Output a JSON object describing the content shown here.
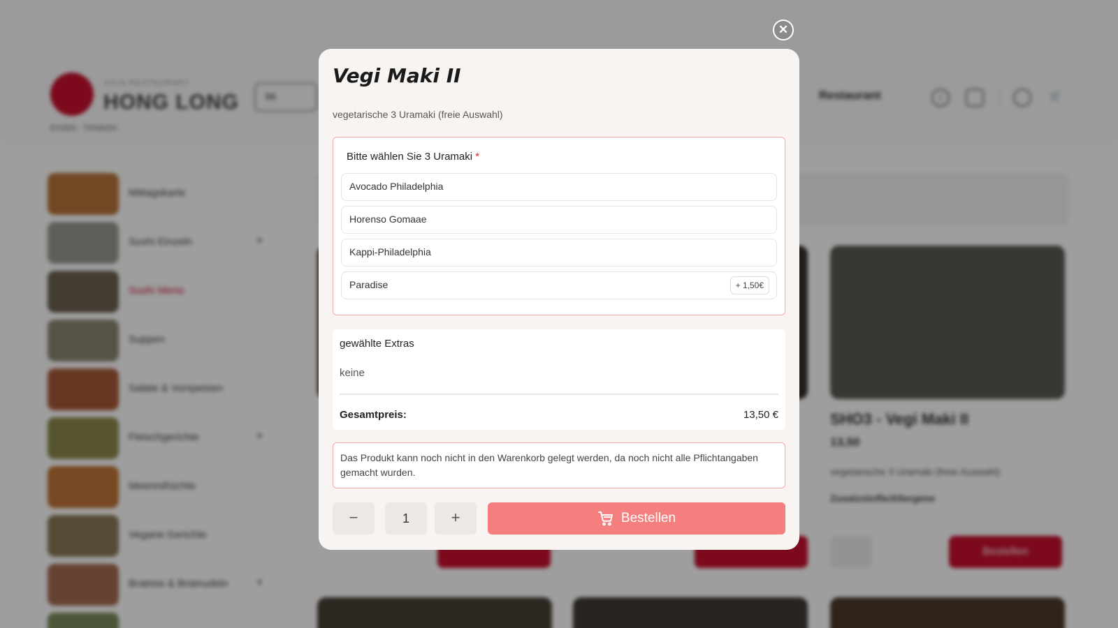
{
  "modal": {
    "title": "Vegi Maki II",
    "description": "vegetarische 3 Uramaki (freie Auswahl)",
    "option_group": {
      "label": "Bitte wählen Sie 3 Uramaki",
      "required_marker": "*",
      "options": [
        {
          "name": "Avocado Philadelphia",
          "surcharge": ""
        },
        {
          "name": "Horenso Gomaae",
          "surcharge": ""
        },
        {
          "name": "Kappi-Philadelphia",
          "surcharge": ""
        },
        {
          "name": "Paradise",
          "surcharge": "+ 1,50€"
        }
      ]
    },
    "extras": {
      "title": "gewählte Extras",
      "value": "keine",
      "total_label": "Gesamtpreis:",
      "total_value": "13,50 €"
    },
    "warning": "Das Produkt kann noch nicht in den Warenkorb gelegt werden, da noch nicht alle Pflichtangaben gemacht wurden.",
    "quantity": {
      "minus": "−",
      "value": "1",
      "plus": "+"
    },
    "order_button": "Bestellen",
    "close": "✕"
  },
  "background": {
    "brand": "HONG LONG",
    "sidebar_active_index": 2,
    "card": {
      "title": "SHO3 - Vegi Maki II",
      "price": "13,50",
      "order_label": "Bestellen"
    },
    "header_link": "Restaurant"
  },
  "colors": {
    "accent": "#f57f7f",
    "brand_red": "#c8102e",
    "required": "#e02424",
    "warning_border": "#f6a5a5"
  },
  "icons": [
    "close-icon",
    "cart-icon",
    "user-icon",
    "cart-header-icon"
  ]
}
